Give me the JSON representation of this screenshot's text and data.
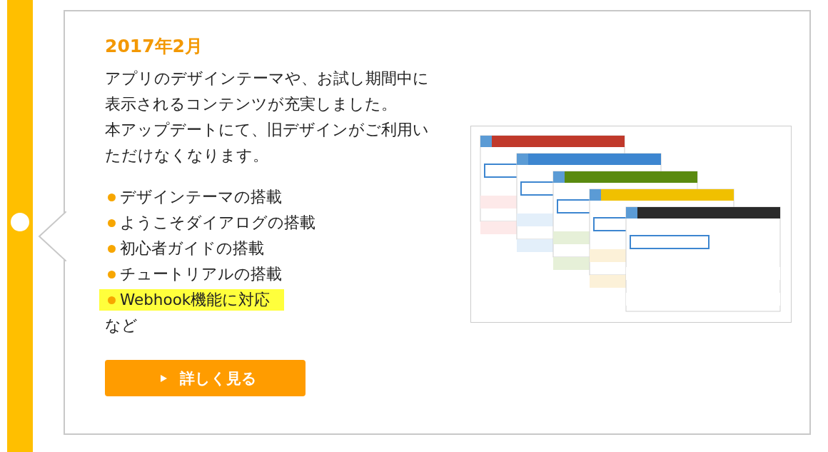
{
  "entry": {
    "date": "2017年2月",
    "description": [
      "アプリのデザインテーマや、お試し期間中に",
      "表示されるコンテンツが充実しました。",
      "本アップデートにて、旧デザインがご利用い",
      "ただけなくなります。"
    ],
    "features": [
      {
        "label": "デザインテーマの搭載",
        "highlighted": false
      },
      {
        "label": "ようこそダイアログの搭載",
        "highlighted": false
      },
      {
        "label": "初心者ガイドの搭載",
        "highlighted": false
      },
      {
        "label": "チュートリアルの搭載",
        "highlighted": false
      },
      {
        "label": "Webhook機能に対応",
        "highlighted": true
      }
    ],
    "closing": "など",
    "button": "詳しく見る",
    "image": {
      "kind": "picture"
    }
  }
}
